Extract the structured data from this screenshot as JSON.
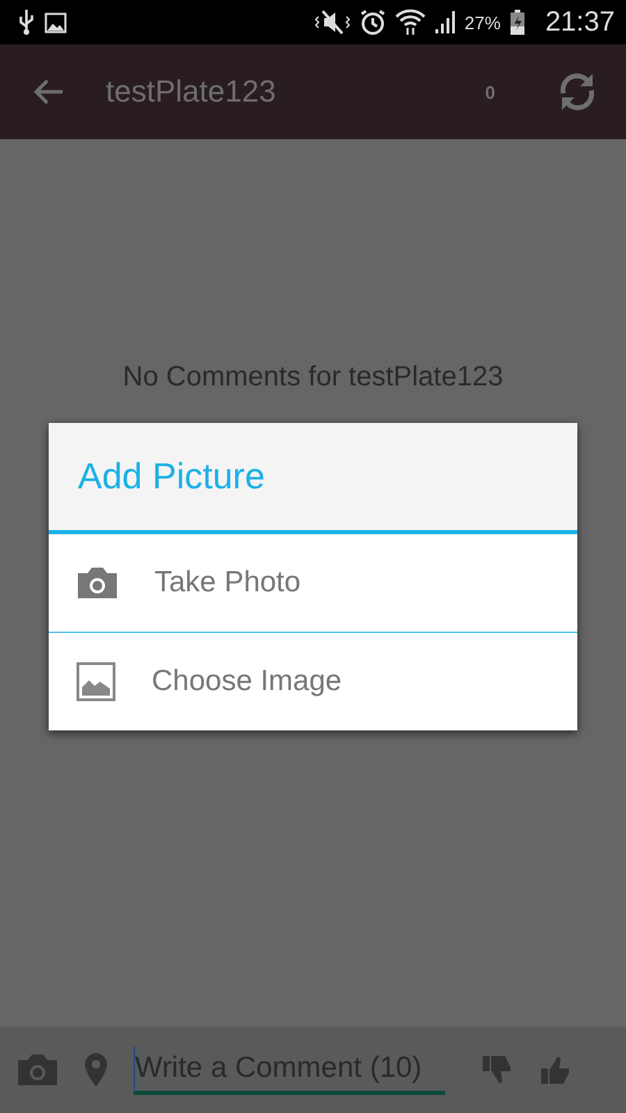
{
  "status_bar": {
    "battery": "27%",
    "time": "21:37"
  },
  "app_bar": {
    "title": "testPlate123",
    "count": "0"
  },
  "empty_message": "No Comments for testPlate123",
  "dialog": {
    "title": "Add Picture",
    "options": [
      {
        "kind": "camera",
        "label": "Take Photo"
      },
      {
        "kind": "gallery",
        "label": "Choose Image"
      }
    ]
  },
  "composer": {
    "placeholder": "Write a Comment (10)"
  }
}
